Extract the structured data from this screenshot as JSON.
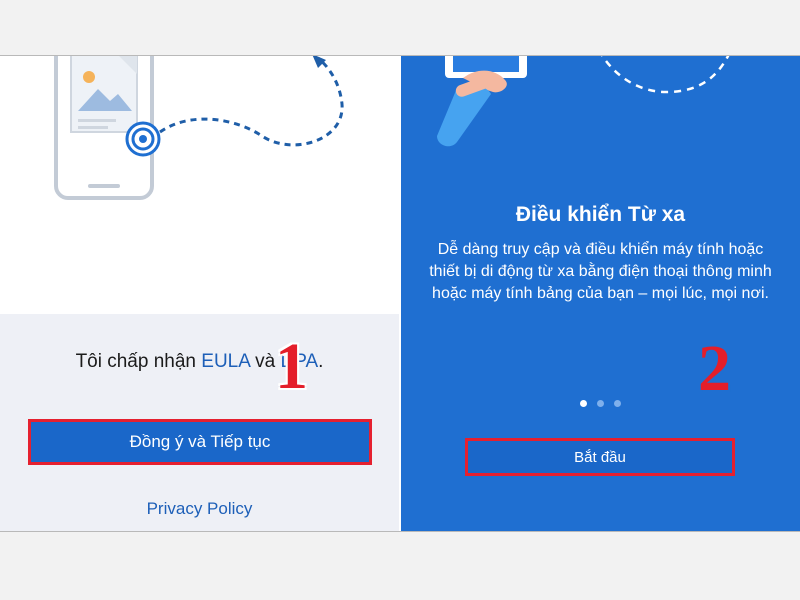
{
  "left_screen": {
    "accept_text": {
      "prefix": "Tôi chấp nhận ",
      "eula_link": "EULA",
      "connector": " và ",
      "dpa_link": "DPA",
      "suffix": "."
    },
    "agree_button_label": "Đồng ý và Tiếp tục",
    "privacy_link_label": "Privacy Policy",
    "step_marker": "1"
  },
  "right_screen": {
    "title": "Điều khiển Từ xa",
    "description": "Dễ dàng truy cập và điều khiển máy tính hoặc thiết bị di động từ xa bằng điện thoại thông minh hoặc máy tính bảng của bạn – mọi lúc, mọi nơi.",
    "pager": {
      "count": 3,
      "active_index": 0
    },
    "start_button_label": "Bắt đầu",
    "step_marker": "2"
  },
  "colors": {
    "brand_blue": "#1f6fd1",
    "button_blue": "#1a67c9",
    "link_blue": "#1d5fb8",
    "highlight_red": "#e5202f"
  }
}
